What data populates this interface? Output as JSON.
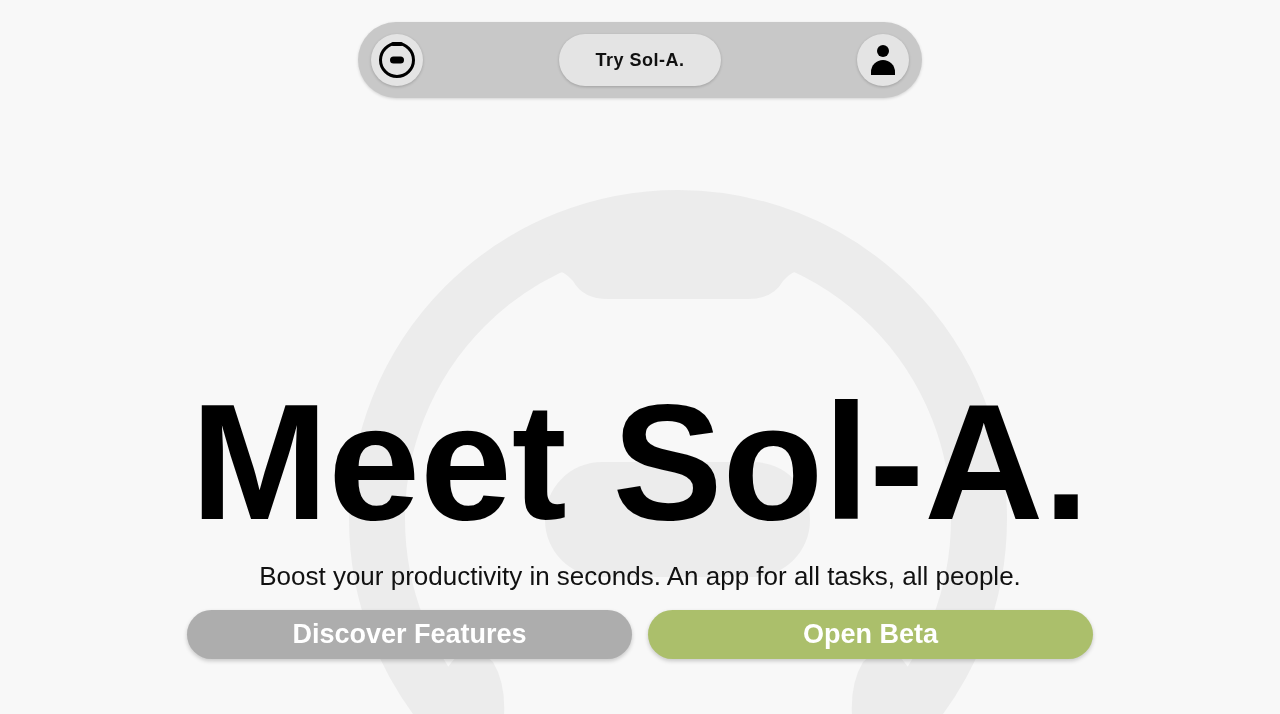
{
  "nav": {
    "cta": "Try Sol-A."
  },
  "hero": {
    "title": "Meet Sol-A.",
    "subtitle": "Boost your productivity in seconds. An app for all tasks, all people."
  },
  "buttons": [
    {
      "label": "Discover Features",
      "kind": "secondary"
    },
    {
      "label": "Open Beta",
      "kind": "primary"
    }
  ]
}
